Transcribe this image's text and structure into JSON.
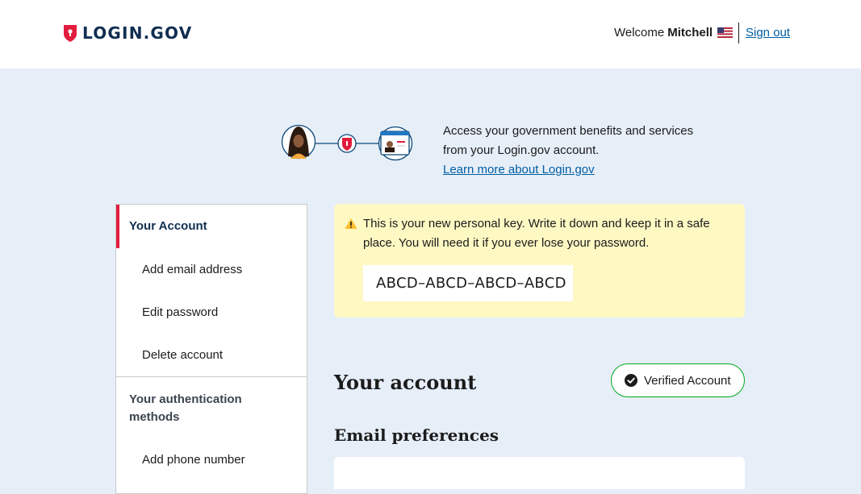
{
  "header": {
    "logo_text": "LOGIN.GOV",
    "welcome_label": "Welcome",
    "user_name": "Mitchell",
    "sign_out_label": "Sign out"
  },
  "hero": {
    "line1": "Access your government benefits and services",
    "line2": "from your Login.gov account.",
    "link_label": "Learn more about Login.gov"
  },
  "sidenav": {
    "current_label": "Your Account",
    "items": [
      {
        "label": "Add email address"
      },
      {
        "label": "Edit password"
      },
      {
        "label": "Delete account"
      }
    ],
    "section_label": "Your authentication methods",
    "section_items": [
      {
        "label": "Add phone number"
      }
    ]
  },
  "alert": {
    "message": "This is your new personal key. Write it down and keep it in a safe place. You will need it if you ever lose your password.",
    "personal_key": "ABCD–ABCD–ABCD–ABCD"
  },
  "main": {
    "title": "Your account",
    "verified_label": "Verified Account",
    "email_heading": "Email preferences"
  },
  "colors": {
    "page_bg": "#e6eef8",
    "brand_navy": "#112e51",
    "brand_red": "#e21c3d",
    "link": "#005ea2",
    "alert_bg": "#fef8c3",
    "verified_green": "#00a91c"
  },
  "icons": [
    "shield-logo-icon",
    "us-flag-icon",
    "warning-icon",
    "check-circle-icon"
  ]
}
